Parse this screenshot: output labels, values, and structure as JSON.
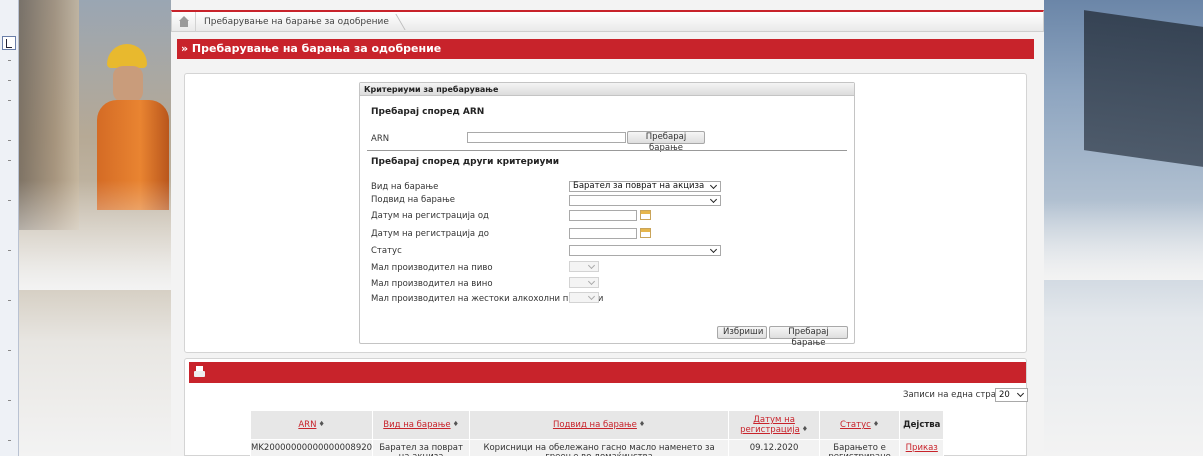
{
  "breadcrumb": {
    "item": "Пребарување на барање за одобрение"
  },
  "page_title": "» Пребарување на барања за одобрение",
  "criteria": {
    "header": "Критериуми за пребарување",
    "arn_section_title": "Пребарај според ARN",
    "arn_label": "ARN",
    "arn_value": "",
    "arn_search_button": "Пребарај барање",
    "other_section_title": "Пребарај според други критериуми",
    "fields": [
      {
        "label": "Вид на барање",
        "value": "Барател за поврат на акциза"
      },
      {
        "label": "Подвид на барање",
        "value": ""
      },
      {
        "label": "Датум на регистрација од",
        "value": ""
      },
      {
        "label": "Датум на регистрација до",
        "value": ""
      },
      {
        "label": "Статус",
        "value": ""
      },
      {
        "label": "Мал производител на пиво",
        "value": ""
      },
      {
        "label": "Мал производител на вино",
        "value": ""
      },
      {
        "label": "Мал производител на жестоки алкохолни пијалаци",
        "value": ""
      }
    ],
    "clear_button": "Избриши",
    "search_button": "Пребарај барање"
  },
  "results": {
    "per_page_label": "Записи на една страна:",
    "per_page_value": "20",
    "columns": [
      "ARN",
      "Вид на барање",
      "Подвид на барање",
      "Датум на регистрација",
      "Статус",
      "Дејства"
    ],
    "sort_marker": "♦",
    "rows": [
      {
        "arn": "MK20000000000000008920",
        "type": "Барател за поврат на акциза",
        "subtype": "Корисници на обележано гасно масло наменето за греење во домаќинства",
        "date": "09.12.2020",
        "status": "Барањето е регистрирано",
        "action": "Приказ"
      }
    ]
  },
  "colors": {
    "accent": "#c8232b",
    "panel_border": "#d4d4d4",
    "header_cell": "#e7e7e7"
  }
}
